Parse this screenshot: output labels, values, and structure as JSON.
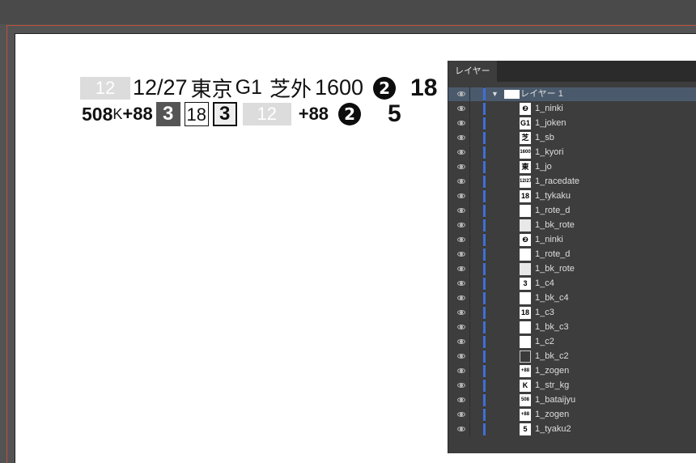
{
  "design": {
    "row1": {
      "box_num": "12",
      "date": "12/27",
      "venue": "東京",
      "grade": "G1",
      "surface": "芝外",
      "distance": "1600",
      "ninki": "2",
      "big": "18"
    },
    "row2": {
      "weight": "508",
      "kg_mark": "K",
      "zogen": "+88",
      "c4": "3",
      "c3": "18",
      "c2": "3",
      "box_num": "12",
      "zogen2": "+88",
      "ninki": "2",
      "big": "5"
    }
  },
  "panel": {
    "tab": "レイヤー",
    "parent_layer": "レイヤー 1",
    "layers": [
      {
        "name": "1_ninki",
        "thumb": "❷",
        "style": "white"
      },
      {
        "name": "1_joken",
        "thumb": "G1",
        "style": "white"
      },
      {
        "name": "1_sb",
        "thumb": "芝外",
        "style": "white"
      },
      {
        "name": "1_kyori",
        "thumb": "1600",
        "style": "white"
      },
      {
        "name": "1_jo",
        "thumb": "東京",
        "style": "white"
      },
      {
        "name": "1_racedate",
        "thumb": "12/27",
        "style": "white"
      },
      {
        "name": "1_tykaku",
        "thumb": "18",
        "style": "white"
      },
      {
        "name": "1_rote_d",
        "thumb": "",
        "style": "white"
      },
      {
        "name": "1_bk_rote",
        "thumb": "",
        "style": "light"
      },
      {
        "name": "1_ninki",
        "thumb": "❷",
        "style": "white"
      },
      {
        "name": "1_rote_d",
        "thumb": "",
        "style": "white"
      },
      {
        "name": "1_bk_rote",
        "thumb": "",
        "style": "light"
      },
      {
        "name": "1_c4",
        "thumb": "3",
        "style": "white"
      },
      {
        "name": "1_bk_c4",
        "thumb": "",
        "style": "white"
      },
      {
        "name": "1_c3",
        "thumb": "18",
        "style": "white"
      },
      {
        "name": "1_bk_c3",
        "thumb": "",
        "style": "white"
      },
      {
        "name": "1_c2",
        "thumb": "",
        "style": "white"
      },
      {
        "name": "1_bk_c2",
        "thumb": "",
        "style": "dark"
      },
      {
        "name": "1_zogen",
        "thumb": "+88",
        "style": "white"
      },
      {
        "name": "1_str_kg",
        "thumb": "K",
        "style": "white"
      },
      {
        "name": "1_bataijyu",
        "thumb": "508",
        "style": "white"
      },
      {
        "name": "1_zogen",
        "thumb": "+88",
        "style": "white"
      },
      {
        "name": "1_tyaku2",
        "thumb": "5",
        "style": "white"
      }
    ]
  },
  "colors": {
    "workspace": "#535353",
    "panel": "#3d3d3d",
    "selection": "#4a5a6c",
    "layer_color_bar": "#3f6fd8",
    "artboard_bleed": "#c0503a"
  }
}
